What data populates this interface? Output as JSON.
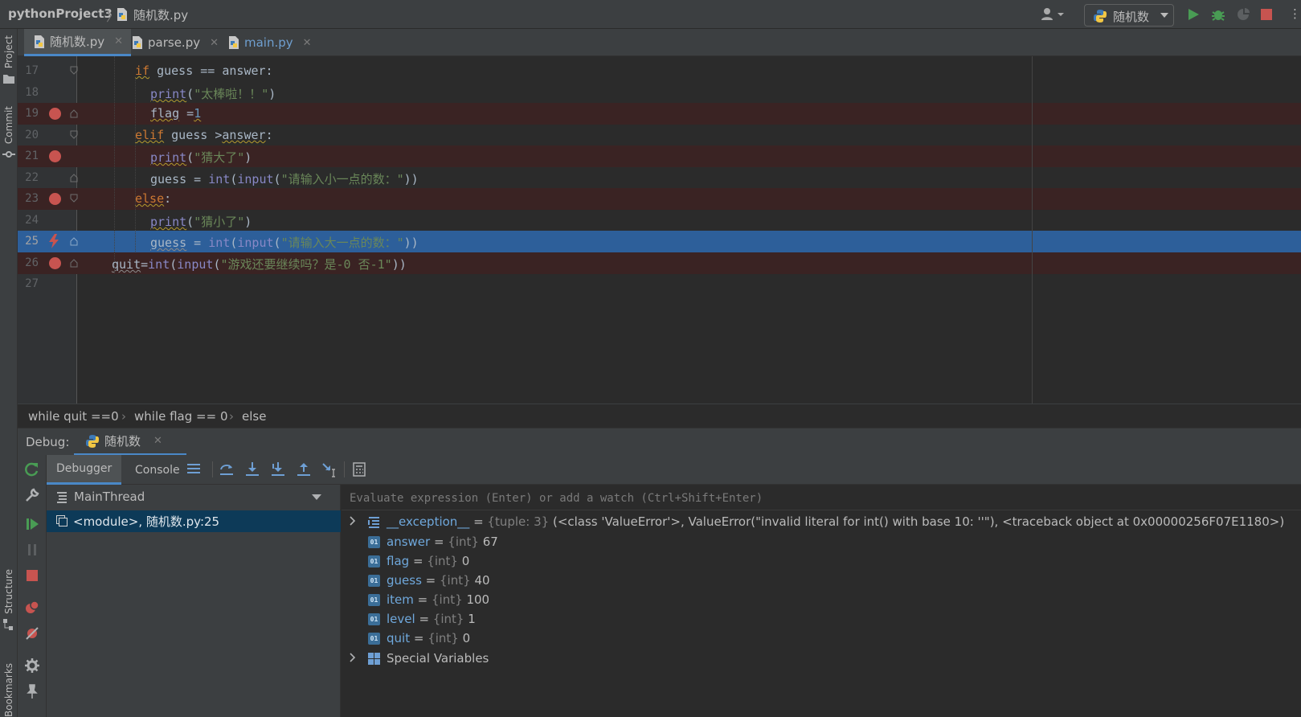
{
  "titlebar": {
    "project": "pythonProject3",
    "file": "随机数.py",
    "run_config": "随机数"
  },
  "sidebar": {
    "project": "Project",
    "commit": "Commit",
    "structure": "Structure",
    "bookmarks": "Bookmarks"
  },
  "tabs": [
    {
      "label": "随机数.py",
      "active": true
    },
    {
      "label": "parse.py",
      "active": false
    },
    {
      "label": "main.py",
      "active": false
    }
  ],
  "code_lines": [
    {
      "num": "17",
      "breakpoint": false
    },
    {
      "num": "18",
      "breakpoint": false
    },
    {
      "num": "19",
      "breakpoint": true
    },
    {
      "num": "20",
      "breakpoint": false
    },
    {
      "num": "21",
      "breakpoint": true
    },
    {
      "num": "22",
      "breakpoint": false
    },
    {
      "num": "23",
      "breakpoint": true
    },
    {
      "num": "24",
      "breakpoint": false
    },
    {
      "num": "25",
      "breakpoint": true,
      "current": true
    },
    {
      "num": "26",
      "breakpoint": true
    },
    {
      "num": "27",
      "breakpoint": false
    }
  ],
  "code": {
    "l17_if": "if",
    "l17_rest": " guess == answer:",
    "l18_fn": "print",
    "l18_open": "(",
    "l18_str": "\"太棒啦！！\"",
    "l18_close": ")",
    "l19_var": "flag",
    "l19_eq": " =",
    "l19_num": "1",
    "l20_kw": "elif",
    "l20_mid": " guess >",
    "l20_ans": "answer",
    "l20_colon": ":",
    "l21_fn": "print",
    "l21_open": "(",
    "l21_str": "\"猜大了\"",
    "l21_close": ")",
    "l22_var": "guess",
    "l22_eq": " = ",
    "l22_int": "int",
    "l22_p1": "(",
    "l22_input": "input",
    "l22_p2": "(",
    "l22_str": "\"请输入小一点的数：\"",
    "l22_close": "))",
    "l23_kw": "else",
    "l23_colon": ":",
    "l24_fn": "print",
    "l24_open": "(",
    "l24_str": "\"猜小了\"",
    "l24_close": ")",
    "l25_var": "guess",
    "l25_eq": " = ",
    "l25_int": "int",
    "l25_p1": "(",
    "l25_input": "input",
    "l25_p2": "(",
    "l25_str": "\"请输入大一点的数：\"",
    "l25_close": "))",
    "l26_var": "quit",
    "l26_eq": "=",
    "l26_int": "int",
    "l26_p1": "(",
    "l26_input": "input",
    "l26_p2": "(",
    "l26_str": "\"游戏还要继续吗？是-0 否-1\"",
    "l26_close": "))"
  },
  "breadcrumb": [
    "while quit ==0",
    "while flag == 0",
    "else"
  ],
  "debug": {
    "label": "Debug:",
    "session": "随机数",
    "tab_debugger": "Debugger",
    "tab_console": "Console",
    "thread": "MainThread",
    "frame": "<module>, 随机数.py:25",
    "eval_placeholder": "Evaluate expression (Enter) or add a watch (Ctrl+Shift+Enter)"
  },
  "variables": [
    {
      "name": "__exception__",
      "type": "{tuple: 3}",
      "value": "(<class 'ValueError'>, ValueError(\"invalid literal for int() with base 10: ''\"), <traceback object at 0x00000256F07E1180>)",
      "expandable": true,
      "icon": "list-icon"
    },
    {
      "name": "answer",
      "type": "{int}",
      "value": "67",
      "icon": "int-icon"
    },
    {
      "name": "flag",
      "type": "{int}",
      "value": "0",
      "icon": "int-icon"
    },
    {
      "name": "guess",
      "type": "{int}",
      "value": "40",
      "icon": "int-icon"
    },
    {
      "name": "item",
      "type": "{int}",
      "value": "100",
      "icon": "int-icon"
    },
    {
      "name": "level",
      "type": "{int}",
      "value": "1",
      "icon": "int-icon"
    },
    {
      "name": "quit",
      "type": "{int}",
      "value": "0",
      "icon": "int-icon"
    }
  ],
  "special_vars": "Special Variables",
  "int_icon_text": "01",
  "colors": {
    "breakpoint": "#c75450",
    "current_line": "#2d5f9a",
    "accent": "#4a88c7"
  }
}
